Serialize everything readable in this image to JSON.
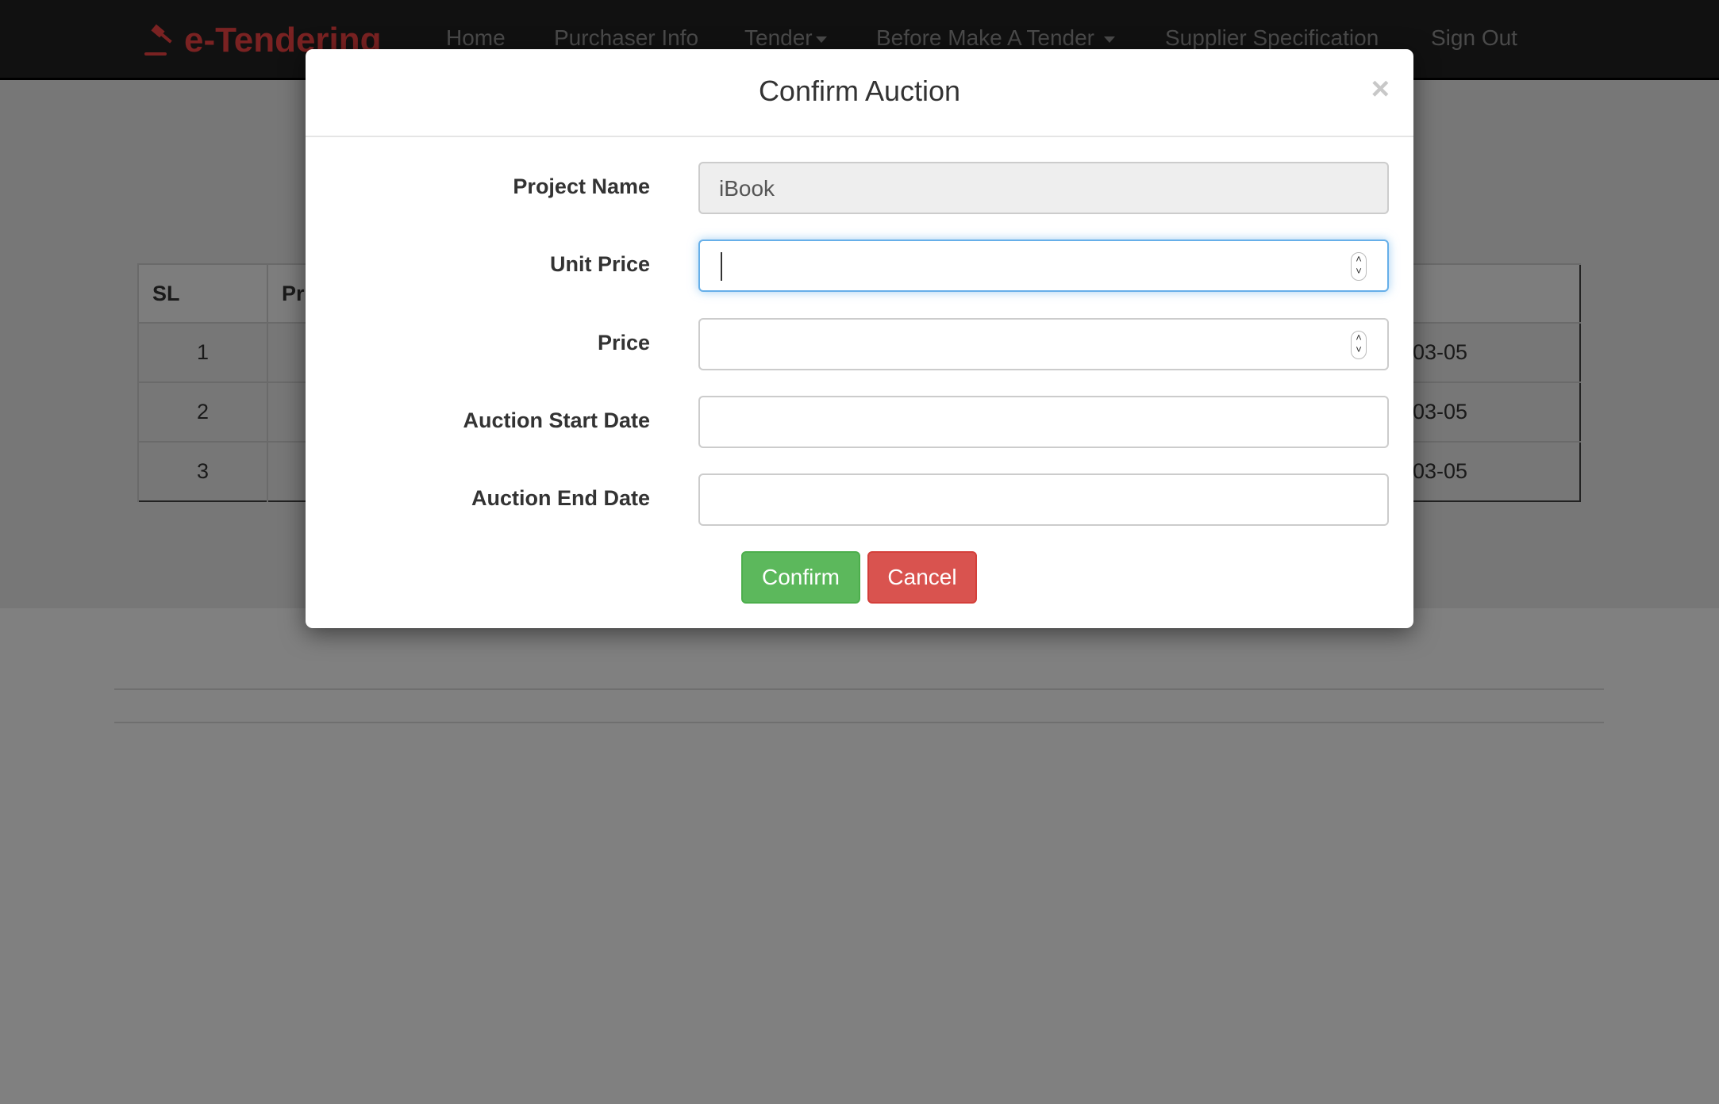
{
  "navbar": {
    "brand": "e-Tendering",
    "items": [
      {
        "label": "Home"
      },
      {
        "label": "Purchaser Info"
      },
      {
        "label": "Tender",
        "dropdown": true
      },
      {
        "label": "Before Make A Tender",
        "dropdown": true
      },
      {
        "label": "Supplier Specification"
      },
      {
        "label": "Sign Out"
      }
    ]
  },
  "table": {
    "headers": [
      "SL",
      "Pr"
    ],
    "rows": [
      {
        "sl": "1",
        "date": "03-05"
      },
      {
        "sl": "2",
        "date": "03-05"
      },
      {
        "sl": "3",
        "date": "03-05"
      }
    ]
  },
  "modal": {
    "title": "Confirm Auction",
    "close": "×",
    "fields": {
      "project_name": {
        "label": "Project Name",
        "value": "iBook",
        "readonly": true
      },
      "unit_price": {
        "label": "Unit Price",
        "value": "",
        "focused": true
      },
      "price": {
        "label": "Price",
        "value": ""
      },
      "start_date": {
        "label": "Auction Start Date",
        "value": ""
      },
      "end_date": {
        "label": "Auction End Date",
        "value": ""
      }
    },
    "confirm_label": "Confirm",
    "cancel_label": "Cancel"
  },
  "colors": {
    "brand": "#7a2222",
    "confirm": "#5cb85c",
    "cancel": "#d9534f",
    "focus": "#66afe9"
  }
}
